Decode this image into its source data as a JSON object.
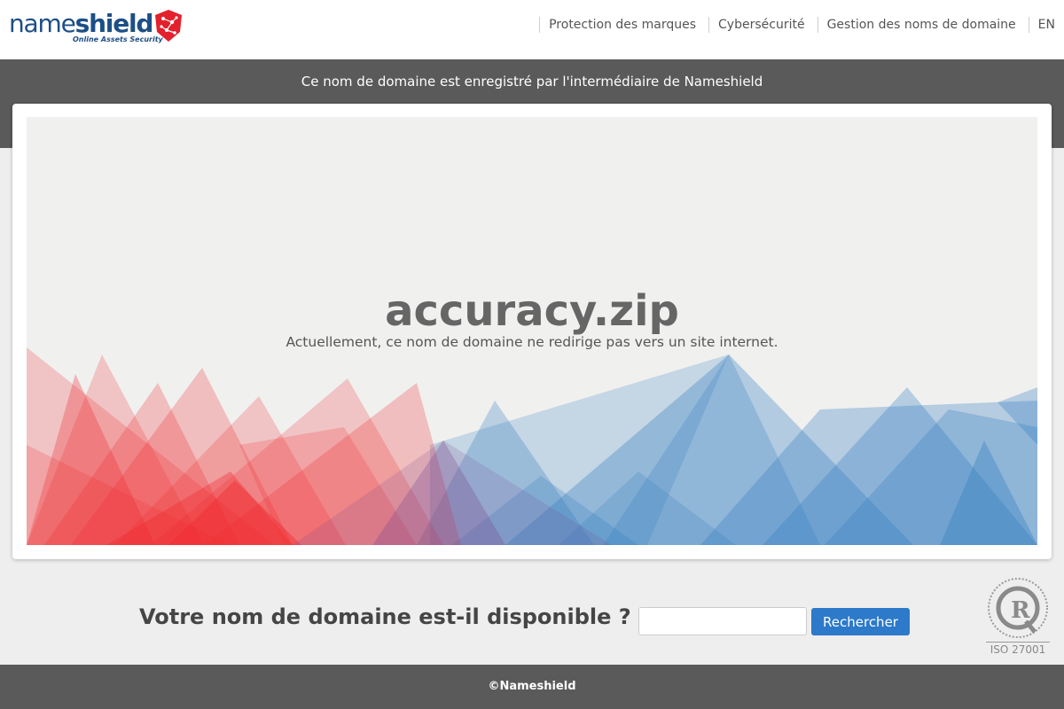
{
  "brand": {
    "name_light": "name",
    "name_bold": "shield",
    "tagline": "Online Assets Security",
    "logo_color": "#1d4f86",
    "emblem_color": "#e2212d"
  },
  "nav": {
    "items": [
      {
        "label": "Protection des marques"
      },
      {
        "label": "Cybersécurité"
      },
      {
        "label": "Gestion des noms de domaine"
      },
      {
        "label": "EN"
      }
    ]
  },
  "banner": {
    "text": "Ce nom de domaine est enregistré par l'intermédiaire de Nameshield"
  },
  "hero": {
    "domain": "accuracy.zip",
    "subtitle": "Actuellement, ce nom de domaine ne redirige pas vers un site internet.",
    "colors": {
      "left": "#f0282d",
      "right": "#2f7bc0"
    }
  },
  "search": {
    "label": "Votre nom de domaine est-il disponible ?",
    "input_value": "",
    "button_label": "Rechercher",
    "button_color": "#2c7ac9"
  },
  "certification": {
    "label": "ISO 27001",
    "ring_text": "LLOYD'S REGISTER LRQA"
  },
  "footer": {
    "text": "©Nameshield"
  }
}
